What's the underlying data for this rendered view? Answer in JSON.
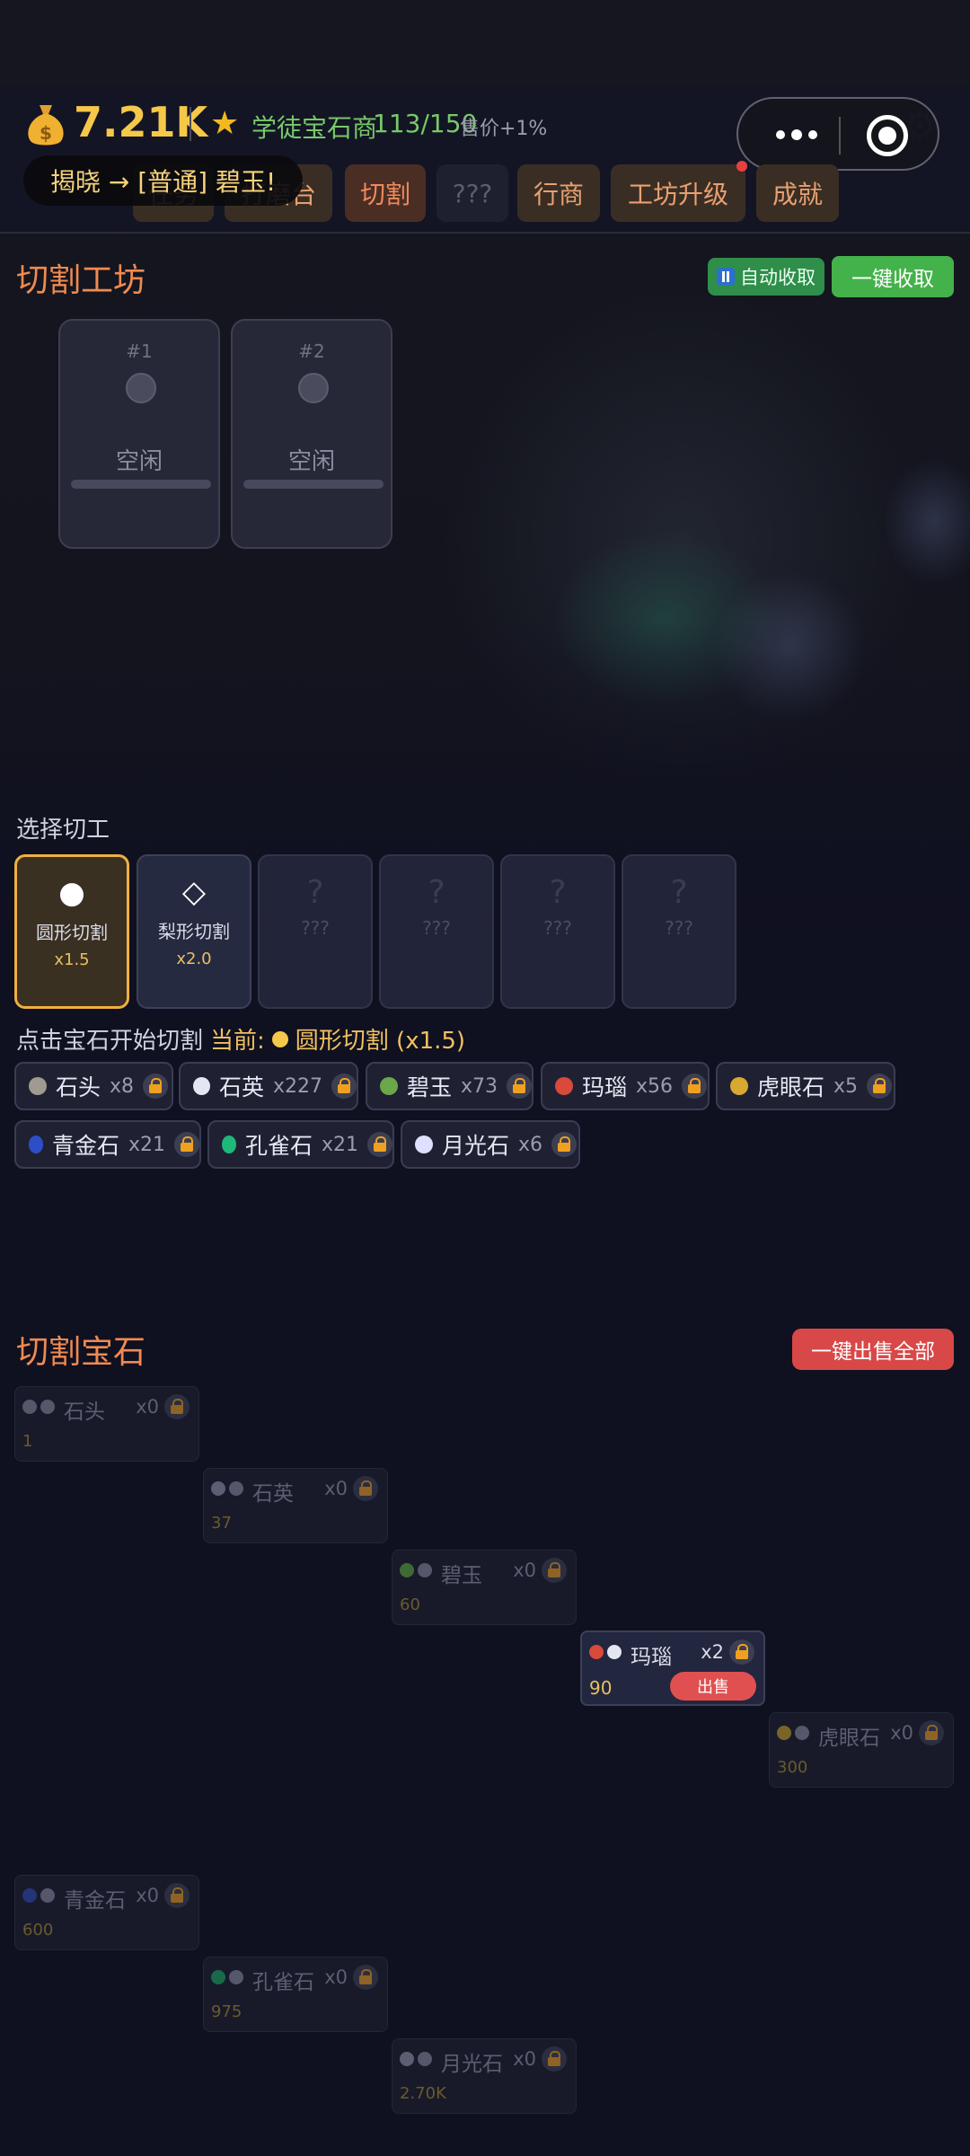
{
  "header": {
    "money_icon": "money-bag-icon",
    "money": "7.21K",
    "rank_title": "学徒宝石商",
    "rank_progress": "113/150",
    "price_bonus": "售价+1%",
    "toast": "揭晓 → [普通] 碧玉!"
  },
  "tabs": [
    {
      "label": "任务",
      "state": "normal"
    },
    {
      "label": "打磨台",
      "state": "normal"
    },
    {
      "label": "切割",
      "state": "active"
    },
    {
      "label": "???",
      "state": "locked"
    },
    {
      "label": "行商",
      "state": "normal"
    },
    {
      "label": "工坊升级",
      "state": "normal",
      "notify": true
    },
    {
      "label": "成就",
      "state": "normal"
    }
  ],
  "workshop": {
    "title": "切割工坊",
    "auto_collect": "自动收取",
    "collect_all": "一键收取",
    "slots": [
      {
        "num": "#1",
        "status": "空闲"
      },
      {
        "num": "#2",
        "status": "空闲"
      }
    ]
  },
  "cut_select": {
    "label": "选择切工",
    "cuts": [
      {
        "icon": "●",
        "name": "圆形切割",
        "mult": "x1.5",
        "state": "selected"
      },
      {
        "icon": "◇",
        "name": "梨形切割",
        "mult": "x2.0",
        "state": "available"
      },
      {
        "icon": "?",
        "name": "???",
        "mult": "",
        "state": "locked"
      },
      {
        "icon": "?",
        "name": "???",
        "mult": "",
        "state": "locked"
      },
      {
        "icon": "?",
        "name": "???",
        "mult": "",
        "state": "locked"
      },
      {
        "icon": "?",
        "name": "???",
        "mult": "",
        "state": "locked"
      }
    ],
    "hint": "点击宝石开始切割",
    "current_label": "当前:",
    "current_value": "圆形切割 (x1.5)"
  },
  "raw_gems": [
    {
      "name": "石头",
      "qty": "x8",
      "color": "#a09a90"
    },
    {
      "name": "石英",
      "qty": "x227",
      "color": "#e4e6f2"
    },
    {
      "name": "碧玉",
      "qty": "x73",
      "color": "#6aa84a"
    },
    {
      "name": "玛瑙",
      "qty": "x56",
      "color": "#d84a3a"
    },
    {
      "name": "虎眼石",
      "qty": "x5",
      "color": "#d8a830"
    },
    {
      "name": "青金石",
      "qty": "x21",
      "color": "#2e4ec8"
    },
    {
      "name": "孔雀石",
      "qty": "x21",
      "color": "#1eb87a"
    },
    {
      "name": "月光石",
      "qty": "x6",
      "color": "#dde0ff"
    }
  ],
  "cut_gems": {
    "title": "切割宝石",
    "sell_all": "一键出售全部",
    "sell_label": "出售",
    "items": [
      {
        "name": "石头",
        "qty": "x0",
        "value": "1",
        "color": "#55586a",
        "active": false
      },
      {
        "name": "石英",
        "qty": "x0",
        "value": "37",
        "color": "#5c5f72",
        "active": false
      },
      {
        "name": "碧玉",
        "qty": "x0",
        "value": "60",
        "color": "#3e6a36",
        "active": false
      },
      {
        "name": "玛瑙",
        "qty": "x2",
        "value": "90",
        "color": "#d84a3a",
        "active": true
      },
      {
        "name": "虎眼石",
        "qty": "x0",
        "value": "300",
        "color": "#7a6428",
        "active": false
      },
      {
        "name": "青金石",
        "qty": "x0",
        "value": "600",
        "color": "#24347a",
        "active": false
      },
      {
        "name": "孔雀石",
        "qty": "x0",
        "value": "975",
        "color": "#1a6a4a",
        "active": false
      },
      {
        "name": "月光石",
        "qty": "x0",
        "value": "2.70K",
        "color": "#5c5f72",
        "active": false
      }
    ]
  }
}
